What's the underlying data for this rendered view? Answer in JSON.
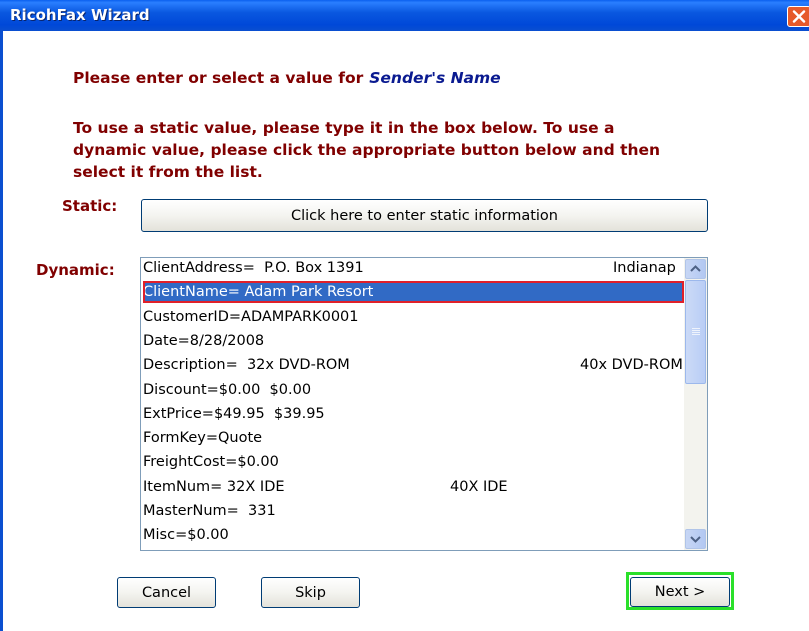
{
  "window": {
    "title": "RicohFax Wizard"
  },
  "prompt": {
    "line1": "Please enter or select a value for",
    "field_name": "Sender's Name",
    "instructions": [
      "To use a static value, please type it in the box below.  To use a",
      "dynamic value, please click the appropriate button below and then",
      "select it from the list."
    ]
  },
  "static": {
    "label": "Static:",
    "button": "Click here to enter static information"
  },
  "dynamic": {
    "label": "Dynamic:",
    "items": [
      {
        "text": "ClientAddress=  P.O. Box 1391",
        "col2": "Indianap",
        "selected": false
      },
      {
        "text": "ClientName= Adam Park Resort",
        "col2": "",
        "selected": true
      },
      {
        "text": "CustomerID=ADAMPARK0001",
        "col2": "",
        "selected": false
      },
      {
        "text": "Date=8/28/2008",
        "col2": "",
        "selected": false
      },
      {
        "text": "Description=  32x DVD-ROM",
        "col2": "40x DVD-ROM",
        "selected": false
      },
      {
        "text": "Discount=$0.00  $0.00",
        "col2": "",
        "selected": false
      },
      {
        "text": "ExtPrice=$49.95  $39.95",
        "col2": "",
        "selected": false
      },
      {
        "text": "FormKey=Quote",
        "col2": "",
        "selected": false
      },
      {
        "text": "FreightCost=$0.00",
        "col2": "",
        "selected": false
      },
      {
        "text": "ItemNum= 32X IDE",
        "col2": "40X IDE",
        "selected": false
      },
      {
        "text": "MasterNum=  331",
        "col2": "",
        "selected": false
      },
      {
        "text": "Misc=$0.00",
        "col2": "",
        "selected": false
      }
    ]
  },
  "buttons": {
    "cancel": "Cancel",
    "skip": "Skip",
    "next": "Next >"
  },
  "colors": {
    "title_bar": "#0A58E0",
    "prompt_text": "#800000",
    "field_name": "#0A1A90",
    "selection": "#316AC5",
    "selection_outline": "#E0202A",
    "next_highlight": "#2AE02A"
  },
  "icons": {
    "close": "close-icon",
    "scroll_up": "chevron-up-icon",
    "scroll_down": "chevron-down-icon"
  }
}
